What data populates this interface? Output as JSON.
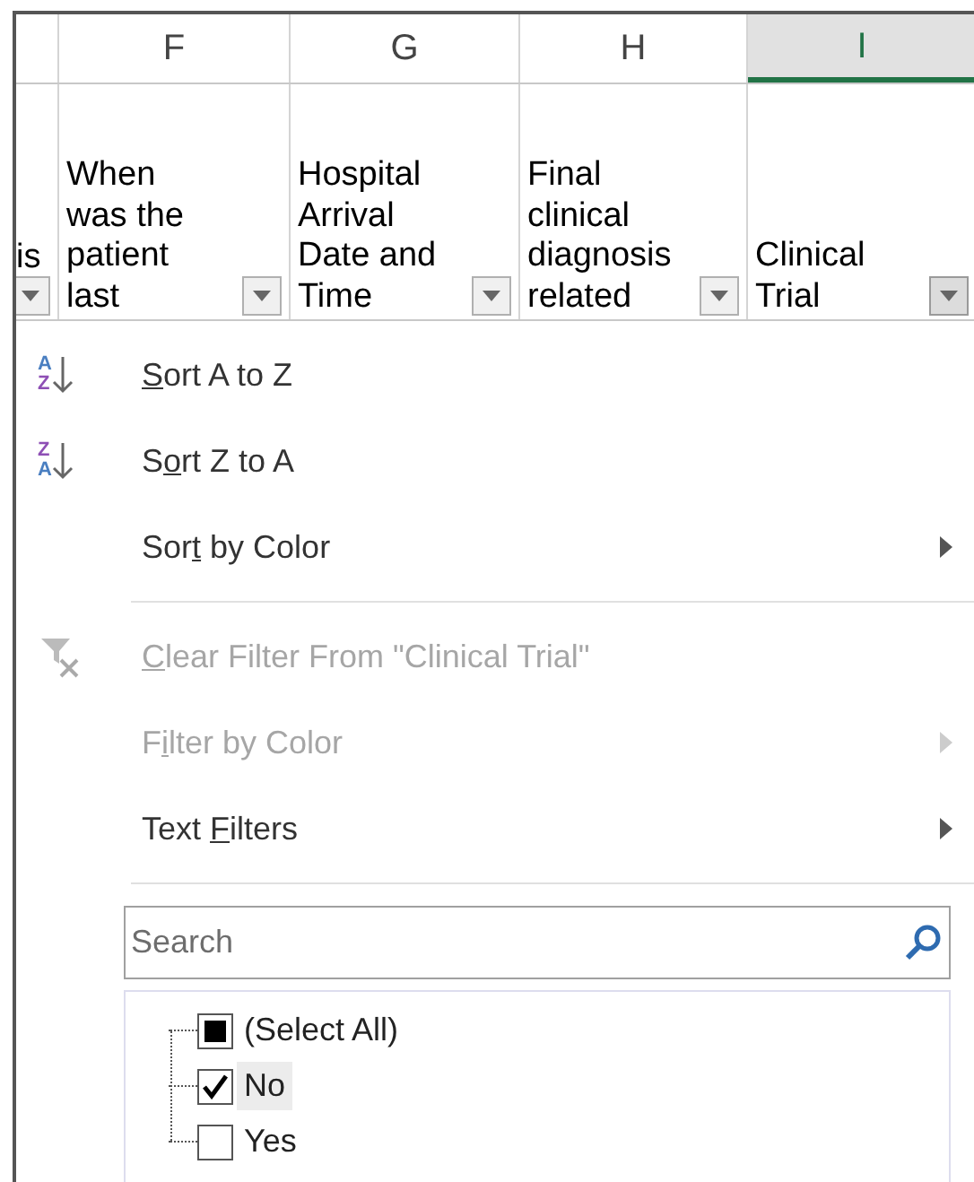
{
  "columns": [
    {
      "header": "is",
      "selected": false
    },
    {
      "letter": "F",
      "header": "When\nwas the\npatient\nlast",
      "selected": false
    },
    {
      "letter": "G",
      "header": "Hospital\nArrival\nDate and\nTime",
      "selected": false
    },
    {
      "letter": "H",
      "header": "Final\nclinical\ndiagnosis\nrelated",
      "selected": false
    },
    {
      "letter": "I",
      "header": "Clinical\nTrial",
      "selected": true
    }
  ],
  "menu": [
    {
      "kind": "sort-az",
      "icon_letters": [
        "A",
        "Z"
      ],
      "key": "S",
      "post": "ort A to Z",
      "disabled": false,
      "submenu": false
    },
    {
      "kind": "sort-za",
      "icon_letters": [
        "Z",
        "A"
      ],
      "pre": "S",
      "key": "o",
      "post": "rt Z to A",
      "disabled": false,
      "submenu": false
    },
    {
      "kind": "plain",
      "pre": "Sor",
      "key": "t",
      "post": " by Color",
      "disabled": false,
      "submenu": true
    },
    {
      "kind": "separator"
    },
    {
      "kind": "clear-filter",
      "key": "C",
      "post": "lear Filter From \"Clinical Trial\"",
      "disabled": true,
      "submenu": false
    },
    {
      "kind": "plain",
      "pre": "F",
      "key": "i",
      "post": "lter by Color",
      "disabled": true,
      "submenu": true
    },
    {
      "kind": "plain",
      "pre": "Text ",
      "key": "F",
      "post": "ilters",
      "disabled": false,
      "submenu": true
    },
    {
      "kind": "separator"
    }
  ],
  "search": {
    "placeholder": "Search"
  },
  "values": [
    {
      "label": "(Select All)",
      "checked": false,
      "indeterminate": true,
      "selected": false
    },
    {
      "label": "No",
      "checked": true,
      "selected": true
    },
    {
      "label": "Yes",
      "checked": false,
      "selected": false
    }
  ]
}
